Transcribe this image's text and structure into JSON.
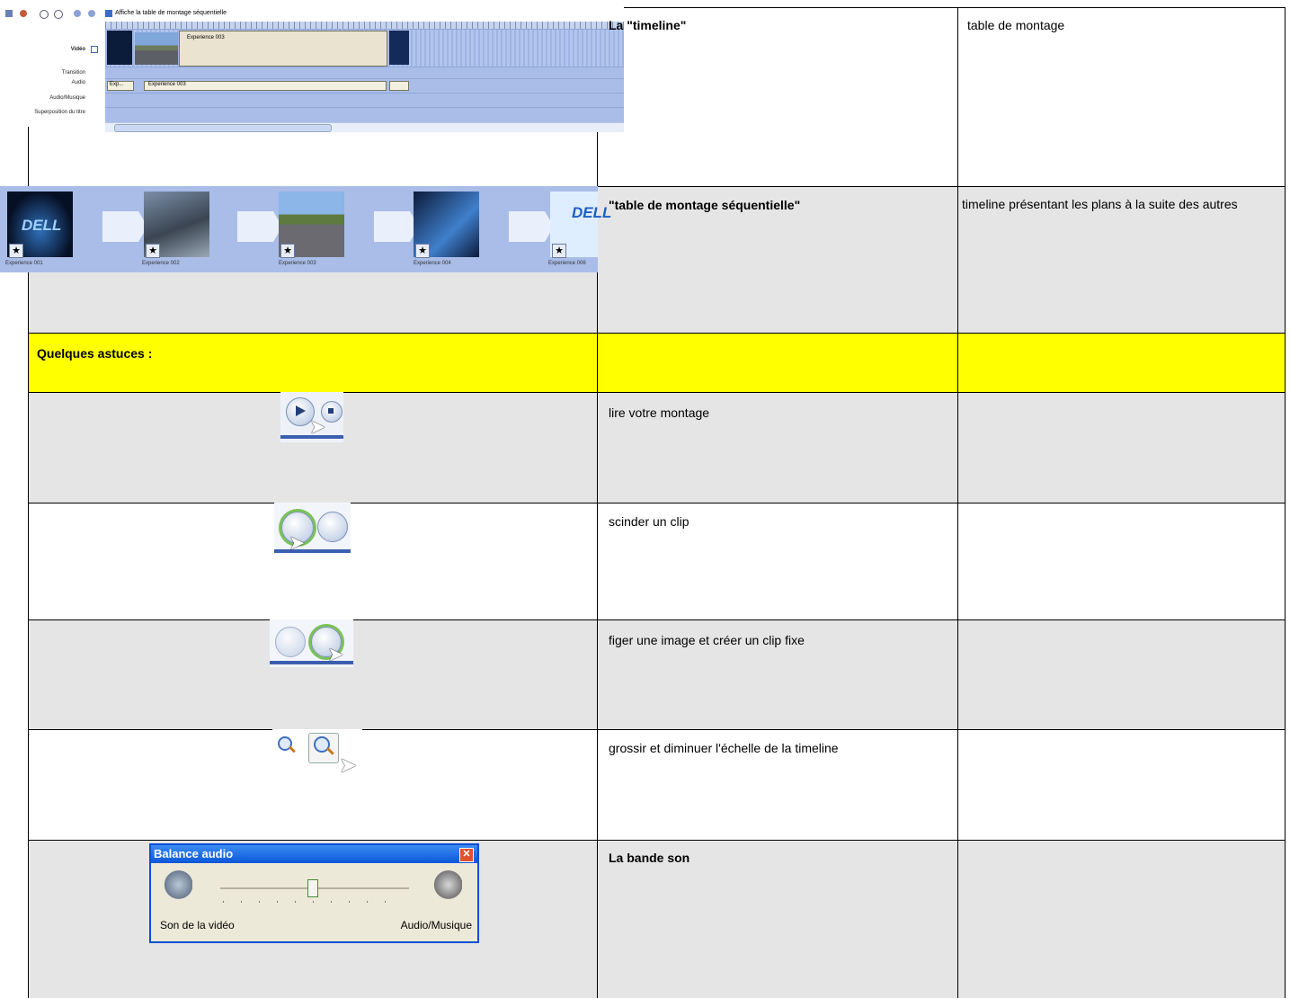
{
  "rows": [
    {
      "col2": "La \"timeline\"",
      "col3": "table de montage"
    },
    {
      "col2": "\"table de montage séquentielle\"",
      "col3": "timeline présentant les plans à la suite des autres"
    },
    {
      "col1": "Quelques astuces :",
      "col2": "",
      "col3": ""
    },
    {
      "col2": "lire votre montage",
      "col3": ""
    },
    {
      "col2": "scinder un clip",
      "col3": ""
    },
    {
      "col2": "figer une image et créer un clip fixe",
      "col3": ""
    },
    {
      "col2": "grossir et diminuer l'échelle de la timeline",
      "col3": ""
    },
    {
      "col2": "La bande son",
      "col3": ""
    }
  ],
  "timeline": {
    "toolbar_label": "Affiche la table de montage séquentielle",
    "tracks": [
      "Vidéo",
      "Transition",
      "Audio",
      "Audio/Musique",
      "Superposition du titre"
    ],
    "video_clip": "Experience 003",
    "audio_clip_short": "Exp...",
    "audio_clip": "Experience 003"
  },
  "storyboard": {
    "captions": [
      "Experience 001",
      "Experience 002",
      "Experience 003",
      "Experience 004",
      "Experience 006"
    ],
    "logo_text": "DELL"
  },
  "balance": {
    "title": "Balance audio",
    "left_label": "Son de la vidéo",
    "right_label": "Audio/Musique",
    "level": 0.48
  },
  "colors": {
    "highlight_row": "#ffff00",
    "shaded_row": "#e5e5e5",
    "lane_blue": "#a9bde8"
  }
}
